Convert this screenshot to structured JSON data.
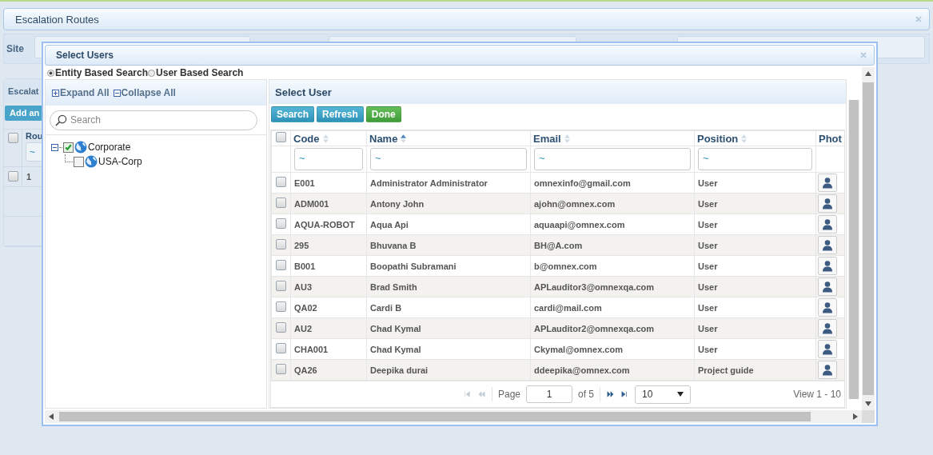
{
  "page": {
    "title": "Escalation Routes",
    "site_label": "Site",
    "section_title": "Escalat",
    "add_button": "Add an",
    "header_checked": false,
    "grid_column": "Rou",
    "grid_filter": "~",
    "grid_rows": [
      {
        "cell": "1",
        "checked": false
      }
    ]
  },
  "dialog": {
    "title": "Select Users",
    "search_modes": [
      {
        "label": "Entity Based Search",
        "selected": true
      },
      {
        "label": "User Based Search",
        "selected": false
      }
    ],
    "tree_panel": {
      "expand_all": "Expand All",
      "collapse_all": "Collapse All",
      "search_placeholder": "Search",
      "tree": [
        {
          "label": "Corporate",
          "checked": true,
          "expanded": true,
          "children": [
            {
              "label": "USA-Corp",
              "checked": false
            }
          ]
        }
      ]
    },
    "users_panel": {
      "title": "Select User",
      "buttons": [
        {
          "label": "Search",
          "kind": "primary"
        },
        {
          "label": "Refresh",
          "kind": "primary"
        },
        {
          "label": "Done",
          "kind": "success"
        }
      ],
      "select_all_checked": false,
      "columns": [
        {
          "label": "Code",
          "sorted": false,
          "filter": "~"
        },
        {
          "label": "Name",
          "sorted": true,
          "filter": "~"
        },
        {
          "label": "Email",
          "sorted": false,
          "filter": "~"
        },
        {
          "label": "Position",
          "sorted": false,
          "filter": "~"
        },
        {
          "label": "Phot"
        }
      ],
      "rows": [
        {
          "checked": false,
          "code": "E001",
          "name": "Administrator Administrator",
          "email": "omnexinfo@gmail.com",
          "position": "User"
        },
        {
          "checked": false,
          "code": "ADM001",
          "name": "Antony John",
          "email": "ajohn@omnex.com",
          "position": "User"
        },
        {
          "checked": false,
          "code": "AQUA-ROBOT",
          "name": "Aqua Api",
          "email": "aquaapi@omnex.com",
          "position": "User"
        },
        {
          "checked": false,
          "code": "295",
          "name": "Bhuvana  B",
          "email": "BH@A.com",
          "position": "User"
        },
        {
          "checked": false,
          "code": "B001",
          "name": "Boopathi Subramani",
          "email": "b@omnex.com",
          "position": "User"
        },
        {
          "checked": false,
          "code": "AU3",
          "name": "Brad Smith",
          "email": "APLauditor3@omnexqa.com",
          "position": "User"
        },
        {
          "checked": false,
          "code": "QA02",
          "name": "Cardi  B",
          "email": "cardi@mail.com",
          "position": "User"
        },
        {
          "checked": false,
          "code": "AU2",
          "name": "Chad Kymal",
          "email": "APLauditor2@omnexqa.com",
          "position": "User"
        },
        {
          "checked": false,
          "code": "CHA001",
          "name": "Chad Kymal",
          "email": "Ckymal@omnex.com",
          "position": "User"
        },
        {
          "checked": false,
          "code": "QA26",
          "name": "Deepika durai",
          "email": "ddeepika@omnex.com",
          "position": "Project guide"
        }
      ],
      "pager": {
        "nav": [
          {
            "kind": "first",
            "disabled": true
          },
          {
            "kind": "prev",
            "disabled": true
          },
          {
            "kind": "next",
            "disabled": false
          },
          {
            "kind": "last",
            "disabled": false
          }
        ],
        "page_label": "Page",
        "page": "1",
        "of": "of 5",
        "page_size": "10",
        "view": "View 1 - 10"
      }
    }
  }
}
